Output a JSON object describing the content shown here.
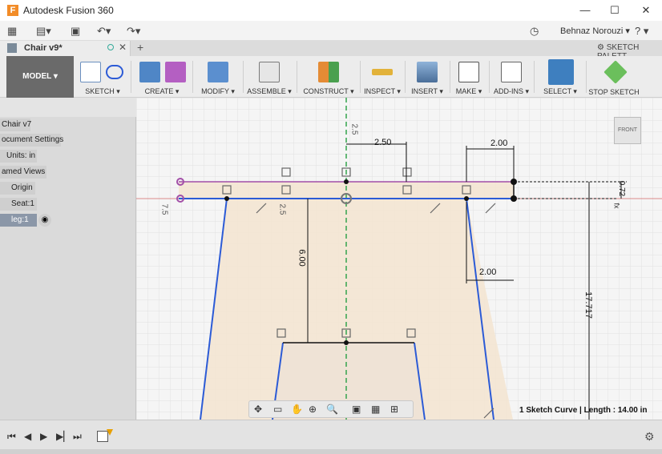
{
  "window": {
    "app_title": "Autodesk Fusion 360",
    "minimize": "—",
    "maximize": "☐",
    "close": "✕"
  },
  "quick_access": {
    "user_name": "Behnaz Norouzi ▾",
    "help": "? ▾"
  },
  "doc_tab": {
    "name": "Chair v9*",
    "sketch_palette": "SKETCH PALETT"
  },
  "ribbon": {
    "model": "MODEL ▾",
    "groups": [
      {
        "label": "SKETCH ▾"
      },
      {
        "label": "CREATE ▾"
      },
      {
        "label": "MODIFY ▾"
      },
      {
        "label": "ASSEMBLE ▾"
      },
      {
        "label": "CONSTRUCT ▾"
      },
      {
        "label": "INSPECT ▾"
      },
      {
        "label": "INSERT ▾"
      },
      {
        "label": "MAKE ▾"
      },
      {
        "label": "ADD-INS ▾"
      },
      {
        "label": "SELECT ▾"
      },
      {
        "label": "STOP SKETCH"
      }
    ]
  },
  "browser": {
    "items": [
      {
        "label": "Chair v7"
      },
      {
        "label": "ocument Settings"
      },
      {
        "label": "Units: in"
      },
      {
        "label": "amed Views"
      },
      {
        "label": "Origin"
      },
      {
        "label": "Seat:1"
      },
      {
        "label": "leg:1"
      }
    ]
  },
  "sketch": {
    "dims": [
      "2.50",
      "2.00",
      "2.00",
      "6.00",
      "17.717",
      "0.72",
      "2.5",
      "2.5",
      "7.5",
      "fx"
    ]
  },
  "viewcube": {
    "label": "FRONT"
  },
  "status": {
    "text": "1 Sketch Curve | Length : 14.00 in"
  },
  "colors": {
    "sketch_line": "#2c5bd6",
    "fill": "#f4e5d3",
    "origin_green": "#33a34d",
    "axis_red": "#d24a4a",
    "constraint_purple": "#a24fa8"
  }
}
